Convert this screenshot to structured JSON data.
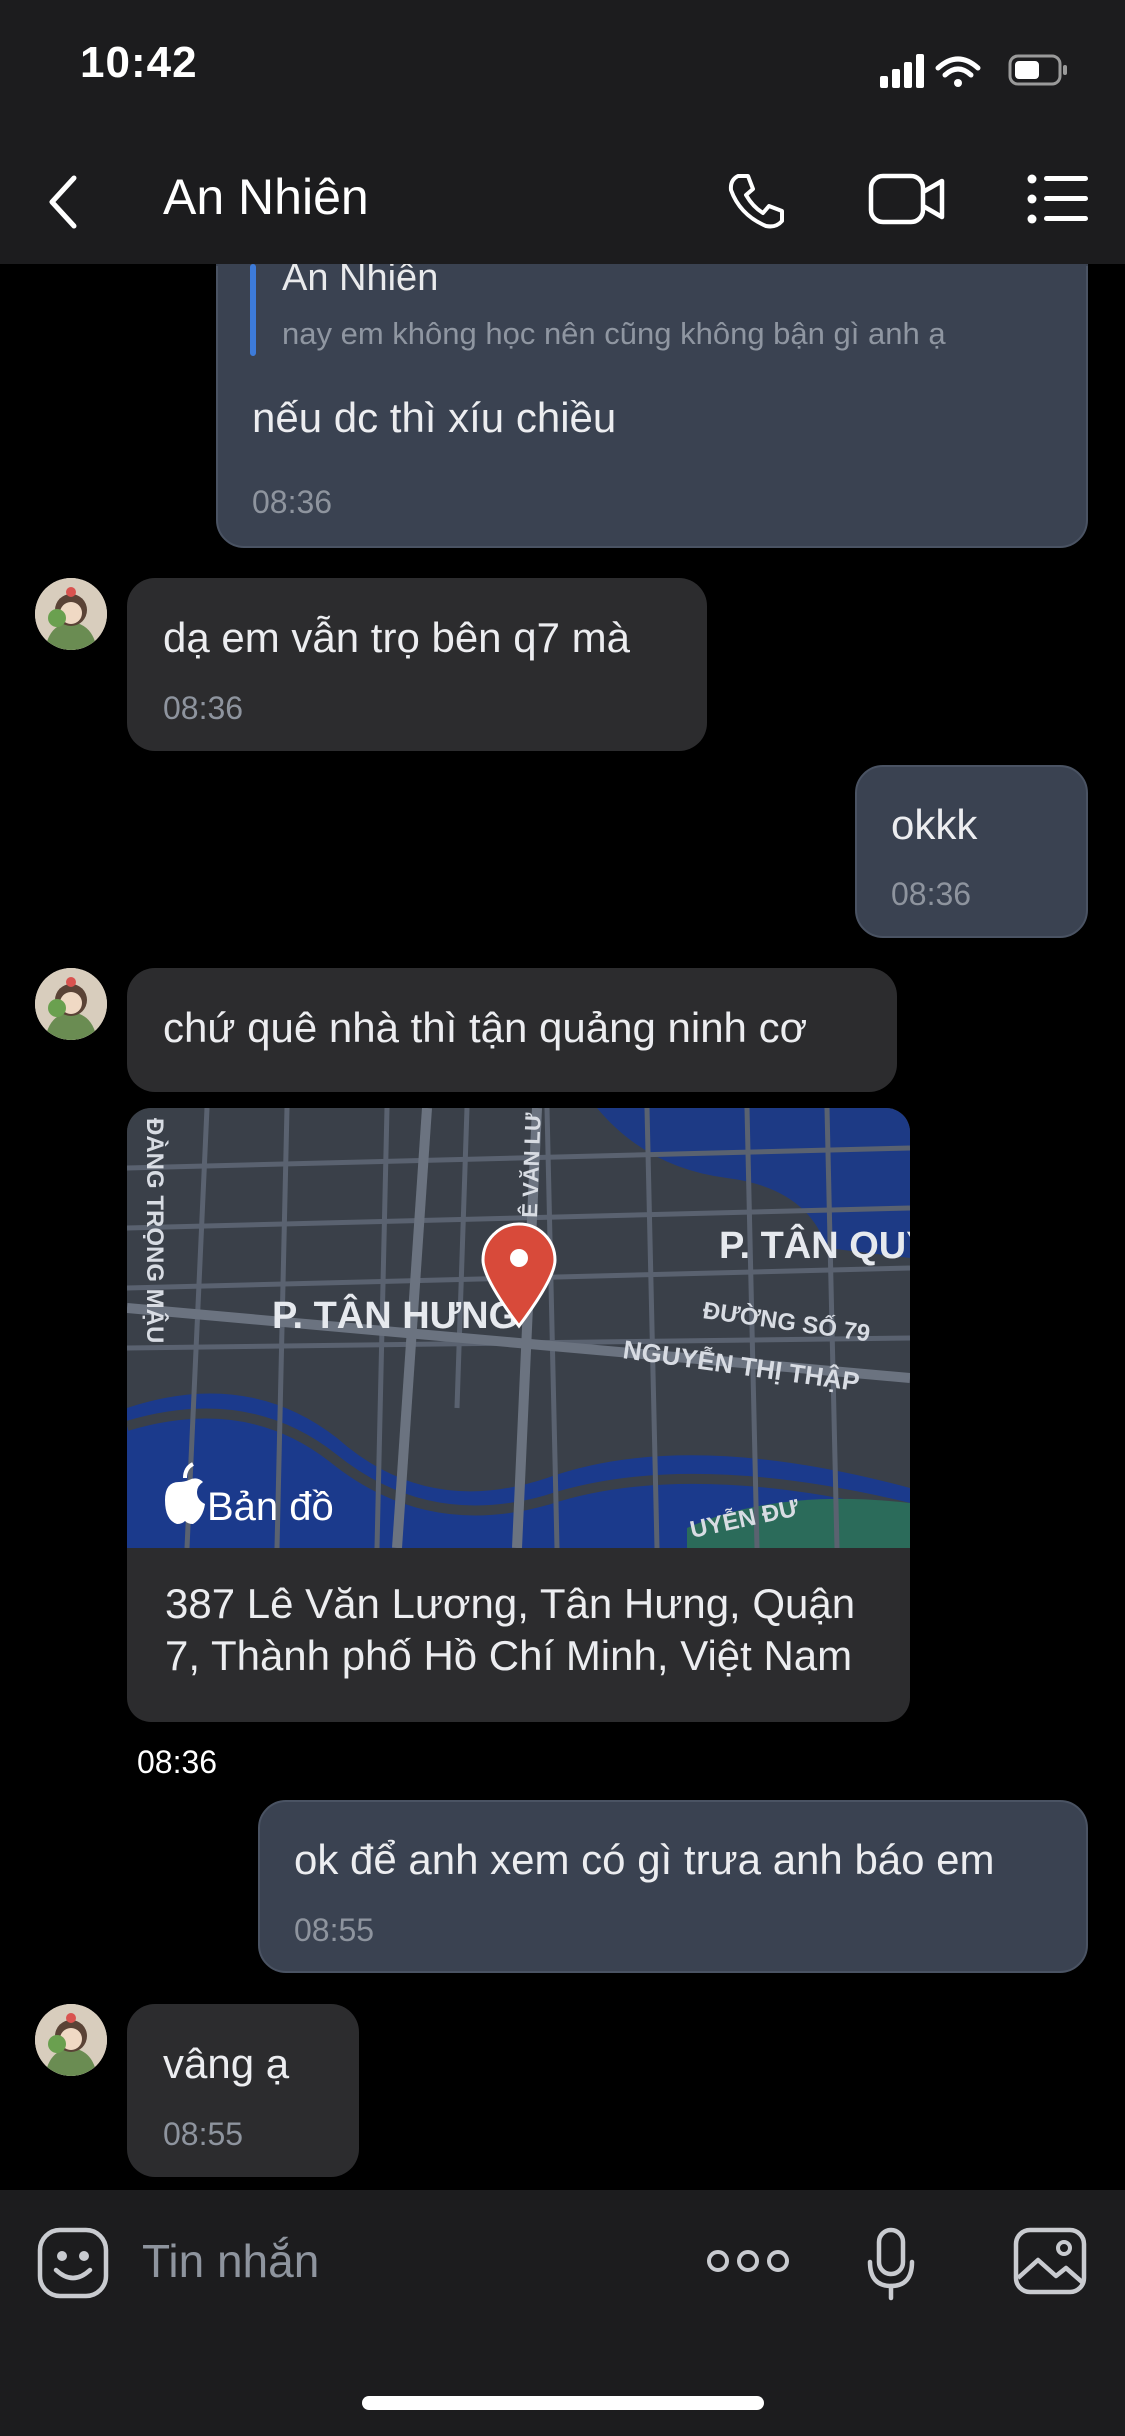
{
  "status_bar": {
    "time": "10:42",
    "icons": [
      "signal-icon",
      "wifi-icon",
      "battery-icon"
    ]
  },
  "header": {
    "back_icon": "chevron-left-icon",
    "title": "An Nhiên",
    "actions": [
      "phone-icon",
      "video-call-icon",
      "menu-list-icon"
    ]
  },
  "messages": [
    {
      "direction": "outgoing",
      "quote": {
        "name": "An Nhiên",
        "text": "nay em không học nên cũng không bận gì anh ạ"
      },
      "text": "nếu dc thì xíu chiều",
      "time": "08:36"
    },
    {
      "direction": "incoming",
      "text": "dạ em vẫn trọ bên q7 mà",
      "time": "08:36"
    },
    {
      "direction": "outgoing",
      "text": "okkk",
      "time": "08:36"
    },
    {
      "direction": "incoming",
      "text": "chứ quê nhà thì tận quảng ninh cơ"
    },
    {
      "direction": "incoming",
      "type": "location",
      "map": {
        "labels": {
          "area_main": "P. TÂN HƯNG",
          "area_right": "P. TÂN QUY",
          "street_1": "ĐƯỜNG SỐ 79",
          "street_2": "NGUYỄN THỊ THẬP",
          "street_3": "ĐÀNG TRỌNG MẬU",
          "street_4": "Ê VĂN LƯ",
          "street_5": "UYỄN ĐƯ"
        },
        "brand": "Bản đồ",
        "pin_color": "#d84a3a"
      },
      "address_line1": "387 Lê Văn Lương, Tân Hưng, Quận",
      "address_line2": "7, Thành phố Hồ Chí Minh, Việt Nam",
      "time": "08:36"
    },
    {
      "direction": "outgoing",
      "text": "ok để anh xem có gì trưa anh báo em",
      "time": "08:55"
    },
    {
      "direction": "incoming",
      "text": "vâng ạ",
      "time": "08:55"
    }
  ],
  "composer": {
    "placeholder": "Tin nhắn",
    "icons": [
      "emoji-icon",
      "more-dots-icon",
      "microphone-icon",
      "image-icon"
    ]
  },
  "colors": {
    "outgoing_bubble": "#3a4251",
    "incoming_bubble": "#2c2c2e",
    "background": "#000000",
    "accent": "#3d7bd9"
  }
}
